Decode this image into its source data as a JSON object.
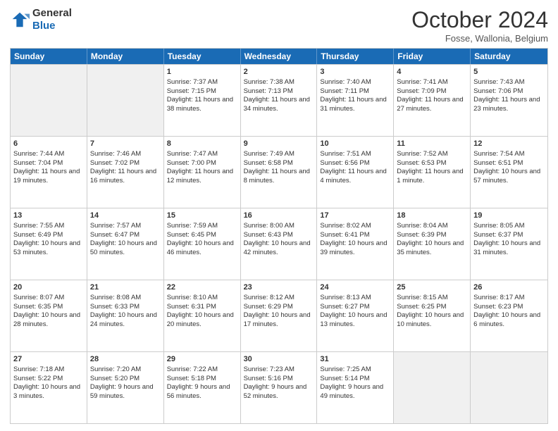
{
  "header": {
    "logo_general": "General",
    "logo_blue": "Blue",
    "month": "October 2024",
    "location": "Fosse, Wallonia, Belgium"
  },
  "weekdays": [
    "Sunday",
    "Monday",
    "Tuesday",
    "Wednesday",
    "Thursday",
    "Friday",
    "Saturday"
  ],
  "weeks": [
    [
      {
        "day": "",
        "sunrise": "",
        "sunset": "",
        "daylight": "",
        "empty": true
      },
      {
        "day": "",
        "sunrise": "",
        "sunset": "",
        "daylight": "",
        "empty": true
      },
      {
        "day": "1",
        "sunrise": "Sunrise: 7:37 AM",
        "sunset": "Sunset: 7:15 PM",
        "daylight": "Daylight: 11 hours and 38 minutes."
      },
      {
        "day": "2",
        "sunrise": "Sunrise: 7:38 AM",
        "sunset": "Sunset: 7:13 PM",
        "daylight": "Daylight: 11 hours and 34 minutes."
      },
      {
        "day": "3",
        "sunrise": "Sunrise: 7:40 AM",
        "sunset": "Sunset: 7:11 PM",
        "daylight": "Daylight: 11 hours and 31 minutes."
      },
      {
        "day": "4",
        "sunrise": "Sunrise: 7:41 AM",
        "sunset": "Sunset: 7:09 PM",
        "daylight": "Daylight: 11 hours and 27 minutes."
      },
      {
        "day": "5",
        "sunrise": "Sunrise: 7:43 AM",
        "sunset": "Sunset: 7:06 PM",
        "daylight": "Daylight: 11 hours and 23 minutes."
      }
    ],
    [
      {
        "day": "6",
        "sunrise": "Sunrise: 7:44 AM",
        "sunset": "Sunset: 7:04 PM",
        "daylight": "Daylight: 11 hours and 19 minutes."
      },
      {
        "day": "7",
        "sunrise": "Sunrise: 7:46 AM",
        "sunset": "Sunset: 7:02 PM",
        "daylight": "Daylight: 11 hours and 16 minutes."
      },
      {
        "day": "8",
        "sunrise": "Sunrise: 7:47 AM",
        "sunset": "Sunset: 7:00 PM",
        "daylight": "Daylight: 11 hours and 12 minutes."
      },
      {
        "day": "9",
        "sunrise": "Sunrise: 7:49 AM",
        "sunset": "Sunset: 6:58 PM",
        "daylight": "Daylight: 11 hours and 8 minutes."
      },
      {
        "day": "10",
        "sunrise": "Sunrise: 7:51 AM",
        "sunset": "Sunset: 6:56 PM",
        "daylight": "Daylight: 11 hours and 4 minutes."
      },
      {
        "day": "11",
        "sunrise": "Sunrise: 7:52 AM",
        "sunset": "Sunset: 6:53 PM",
        "daylight": "Daylight: 11 hours and 1 minute."
      },
      {
        "day": "12",
        "sunrise": "Sunrise: 7:54 AM",
        "sunset": "Sunset: 6:51 PM",
        "daylight": "Daylight: 10 hours and 57 minutes."
      }
    ],
    [
      {
        "day": "13",
        "sunrise": "Sunrise: 7:55 AM",
        "sunset": "Sunset: 6:49 PM",
        "daylight": "Daylight: 10 hours and 53 minutes."
      },
      {
        "day": "14",
        "sunrise": "Sunrise: 7:57 AM",
        "sunset": "Sunset: 6:47 PM",
        "daylight": "Daylight: 10 hours and 50 minutes."
      },
      {
        "day": "15",
        "sunrise": "Sunrise: 7:59 AM",
        "sunset": "Sunset: 6:45 PM",
        "daylight": "Daylight: 10 hours and 46 minutes."
      },
      {
        "day": "16",
        "sunrise": "Sunrise: 8:00 AM",
        "sunset": "Sunset: 6:43 PM",
        "daylight": "Daylight: 10 hours and 42 minutes."
      },
      {
        "day": "17",
        "sunrise": "Sunrise: 8:02 AM",
        "sunset": "Sunset: 6:41 PM",
        "daylight": "Daylight: 10 hours and 39 minutes."
      },
      {
        "day": "18",
        "sunrise": "Sunrise: 8:04 AM",
        "sunset": "Sunset: 6:39 PM",
        "daylight": "Daylight: 10 hours and 35 minutes."
      },
      {
        "day": "19",
        "sunrise": "Sunrise: 8:05 AM",
        "sunset": "Sunset: 6:37 PM",
        "daylight": "Daylight: 10 hours and 31 minutes."
      }
    ],
    [
      {
        "day": "20",
        "sunrise": "Sunrise: 8:07 AM",
        "sunset": "Sunset: 6:35 PM",
        "daylight": "Daylight: 10 hours and 28 minutes."
      },
      {
        "day": "21",
        "sunrise": "Sunrise: 8:08 AM",
        "sunset": "Sunset: 6:33 PM",
        "daylight": "Daylight: 10 hours and 24 minutes."
      },
      {
        "day": "22",
        "sunrise": "Sunrise: 8:10 AM",
        "sunset": "Sunset: 6:31 PM",
        "daylight": "Daylight: 10 hours and 20 minutes."
      },
      {
        "day": "23",
        "sunrise": "Sunrise: 8:12 AM",
        "sunset": "Sunset: 6:29 PM",
        "daylight": "Daylight: 10 hours and 17 minutes."
      },
      {
        "day": "24",
        "sunrise": "Sunrise: 8:13 AM",
        "sunset": "Sunset: 6:27 PM",
        "daylight": "Daylight: 10 hours and 13 minutes."
      },
      {
        "day": "25",
        "sunrise": "Sunrise: 8:15 AM",
        "sunset": "Sunset: 6:25 PM",
        "daylight": "Daylight: 10 hours and 10 minutes."
      },
      {
        "day": "26",
        "sunrise": "Sunrise: 8:17 AM",
        "sunset": "Sunset: 6:23 PM",
        "daylight": "Daylight: 10 hours and 6 minutes."
      }
    ],
    [
      {
        "day": "27",
        "sunrise": "Sunrise: 7:18 AM",
        "sunset": "Sunset: 5:22 PM",
        "daylight": "Daylight: 10 hours and 3 minutes."
      },
      {
        "day": "28",
        "sunrise": "Sunrise: 7:20 AM",
        "sunset": "Sunset: 5:20 PM",
        "daylight": "Daylight: 9 hours and 59 minutes."
      },
      {
        "day": "29",
        "sunrise": "Sunrise: 7:22 AM",
        "sunset": "Sunset: 5:18 PM",
        "daylight": "Daylight: 9 hours and 56 minutes."
      },
      {
        "day": "30",
        "sunrise": "Sunrise: 7:23 AM",
        "sunset": "Sunset: 5:16 PM",
        "daylight": "Daylight: 9 hours and 52 minutes."
      },
      {
        "day": "31",
        "sunrise": "Sunrise: 7:25 AM",
        "sunset": "Sunset: 5:14 PM",
        "daylight": "Daylight: 9 hours and 49 minutes."
      },
      {
        "day": "",
        "sunrise": "",
        "sunset": "",
        "daylight": "",
        "empty": true
      },
      {
        "day": "",
        "sunrise": "",
        "sunset": "",
        "daylight": "",
        "empty": true
      }
    ]
  ]
}
